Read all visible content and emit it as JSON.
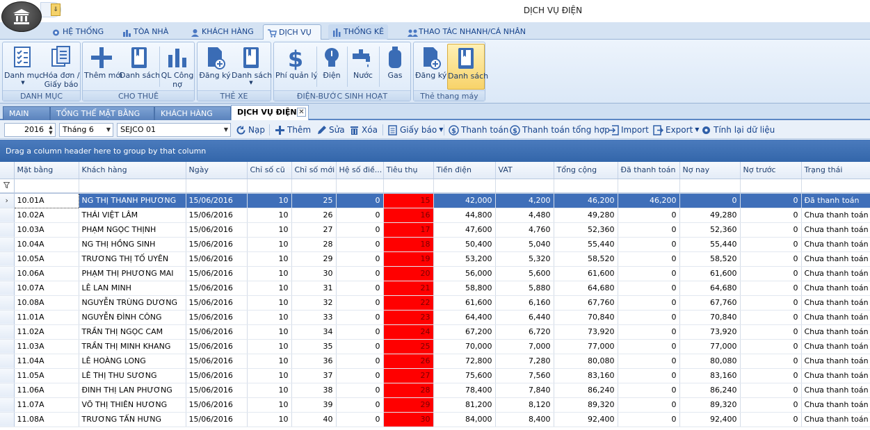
{
  "window_title": "DỊCH VỤ ĐIỆN",
  "qat_drop": "⇓",
  "ribbon_tabs": [
    {
      "label": "HỆ THỐNG",
      "icon": "gear-icon"
    },
    {
      "label": "TÒA NHÀ",
      "icon": "chart-icon"
    },
    {
      "label": "KHÁCH HÀNG",
      "icon": "customer-icon"
    },
    {
      "label": "DỊCH VỤ",
      "icon": "cart-icon"
    },
    {
      "label": "THỐNG KÊ",
      "icon": "stats-icon"
    },
    {
      "label": "THAO TÁC NHANH/CÁ NHÂN",
      "icon": "users-icon"
    }
  ],
  "ribbon_groups": [
    {
      "label": "DANH MỤC",
      "buttons": [
        {
          "label": "Danh mục"
        },
        {
          "label": "Hóa đơn /",
          "label2": "Giấy báo"
        }
      ]
    },
    {
      "label": "CHO THUÊ",
      "buttons": [
        {
          "label": "Thêm mới"
        },
        {
          "label": "Danh sách"
        },
        {
          "label": "QL Công",
          "label2": "nợ"
        }
      ]
    },
    {
      "label": "THẺ XE",
      "buttons": [
        {
          "label": "Đăng ký"
        },
        {
          "label": "Danh sách"
        }
      ]
    },
    {
      "label": "ĐIỆN-BƯỚC SINH HOẠT",
      "buttons": [
        {
          "label": "Phí quản lý"
        },
        {
          "label": "Điện"
        },
        {
          "label": "Nước"
        },
        {
          "label": "Gas"
        }
      ]
    },
    {
      "label": "Thẻ thang máy",
      "buttons": [
        {
          "label": "Đăng ký"
        },
        {
          "label": "Danh sách"
        }
      ]
    }
  ],
  "doc_tabs": [
    "MAIN",
    "TỔNG THỂ MẶT BẰNG",
    "KHÁCH HÀNG",
    "DỊCH VỤ ĐIỆN"
  ],
  "toolbar": {
    "year": "2016",
    "month": "Tháng 6",
    "building": "SEJCO 01",
    "buttons": {
      "reload": "Nạp",
      "add": "Thêm",
      "edit": "Sửa",
      "delete": "Xóa",
      "notice": "Giấy báo",
      "pay": "Thanh toán",
      "pay_all": "Thanh toán tổng hợp",
      "import": "Import",
      "export": "Export",
      "recalc": "Tính lại dữ liệu"
    }
  },
  "group_hint": "Drag a column header here to group by that column",
  "columns": [
    "Mặt bằng",
    "Khách hàng",
    "Ngày",
    "Chỉ số cũ",
    "Chỉ số mới",
    "Hệ số điề...",
    "Tiêu thụ",
    "Tiền điện",
    "VAT",
    "Tổng cộng",
    "Đã thanh toán",
    "Nợ nay",
    "Nợ trước",
    "Trạng thái"
  ],
  "rows": [
    [
      "10.01A",
      "NG THỊ THANH PHƯƠNG",
      "15/06/2016",
      "10",
      "25",
      "0",
      "15",
      "42,000",
      "4,200",
      "46,200",
      "46,200",
      "0",
      "0",
      "Đã thanh toán"
    ],
    [
      "10.02A",
      "THÁI VIỆT LÂM",
      "15/06/2016",
      "10",
      "26",
      "0",
      "16",
      "44,800",
      "4,480",
      "49,280",
      "0",
      "49,280",
      "0",
      "Chưa thanh toán"
    ],
    [
      "10.03A",
      "PHẠM NGỌC THỊNH",
      "15/06/2016",
      "10",
      "27",
      "0",
      "17",
      "47,600",
      "4,760",
      "52,360",
      "0",
      "52,360",
      "0",
      "Chưa thanh toán"
    ],
    [
      "10.04A",
      "NG THỊ HỒNG SINH",
      "15/06/2016",
      "10",
      "28",
      "0",
      "18",
      "50,400",
      "5,040",
      "55,440",
      "0",
      "55,440",
      "0",
      "Chưa thanh toán"
    ],
    [
      "10.05A",
      "TRƯƠNG THỊ TỐ UYÊN",
      "15/06/2016",
      "10",
      "29",
      "0",
      "19",
      "53,200",
      "5,320",
      "58,520",
      "0",
      "58,520",
      "0",
      "Chưa thanh toán"
    ],
    [
      "10.06A",
      "PHẠM THỊ PHƯƠNG MAI",
      "15/06/2016",
      "10",
      "30",
      "0",
      "20",
      "56,000",
      "5,600",
      "61,600",
      "0",
      "61,600",
      "0",
      "Chưa thanh toán"
    ],
    [
      "10.07A",
      "LÊ LAN MINH",
      "15/06/2016",
      "10",
      "31",
      "0",
      "21",
      "58,800",
      "5,880",
      "64,680",
      "0",
      "64,680",
      "0",
      "Chưa thanh toán"
    ],
    [
      "10.08A",
      "NGUYỄN TRÙNG DƯƠNG",
      "15/06/2016",
      "10",
      "32",
      "0",
      "22",
      "61,600",
      "6,160",
      "67,760",
      "0",
      "67,760",
      "0",
      "Chưa thanh toán"
    ],
    [
      "11.01A",
      "NGUYỄN ĐÌNH CÔNG",
      "15/06/2016",
      "10",
      "33",
      "0",
      "23",
      "64,400",
      "6,440",
      "70,840",
      "0",
      "70,840",
      "0",
      "Chưa thanh toán"
    ],
    [
      "11.02A",
      "TRẦN THỊ NGỌC CAM",
      "15/06/2016",
      "10",
      "34",
      "0",
      "24",
      "67,200",
      "6,720",
      "73,920",
      "0",
      "73,920",
      "0",
      "Chưa thanh toán"
    ],
    [
      "11.03A",
      "TRẦN THỊ MINH KHANG",
      "15/06/2016",
      "10",
      "35",
      "0",
      "25",
      "70,000",
      "7,000",
      "77,000",
      "0",
      "77,000",
      "0",
      "Chưa thanh toán"
    ],
    [
      "11.04A",
      "LÊ HOÀNG LONG",
      "15/06/2016",
      "10",
      "36",
      "0",
      "26",
      "72,800",
      "7,280",
      "80,080",
      "0",
      "80,080",
      "0",
      "Chưa thanh toán"
    ],
    [
      "11.05A",
      "LÊ THỊ THU SƯƠNG",
      "15/06/2016",
      "10",
      "37",
      "0",
      "27",
      "75,600",
      "7,560",
      "83,160",
      "0",
      "83,160",
      "0",
      "Chưa thanh toán"
    ],
    [
      "11.06A",
      "ĐINH THỊ LAN PHƯƠNG",
      "15/06/2016",
      "10",
      "38",
      "0",
      "28",
      "78,400",
      "7,840",
      "86,240",
      "0",
      "86,240",
      "0",
      "Chưa thanh toán"
    ],
    [
      "11.07A",
      "VÕ THỊ THIÊN HƯƠNG",
      "15/06/2016",
      "10",
      "39",
      "0",
      "29",
      "81,200",
      "8,120",
      "89,320",
      "0",
      "89,320",
      "0",
      "Chưa thanh toán"
    ],
    [
      "11.08A",
      "TRƯƠNG TẤN HƯNG",
      "15/06/2016",
      "10",
      "40",
      "0",
      "30",
      "84,000",
      "8,400",
      "92,400",
      "0",
      "92,400",
      "0",
      "Chưa thanh toán"
    ]
  ],
  "colors": {
    "accent": "#3f6fb9",
    "highlight": "#ff0000",
    "ribbon": "#dbe8f7"
  }
}
